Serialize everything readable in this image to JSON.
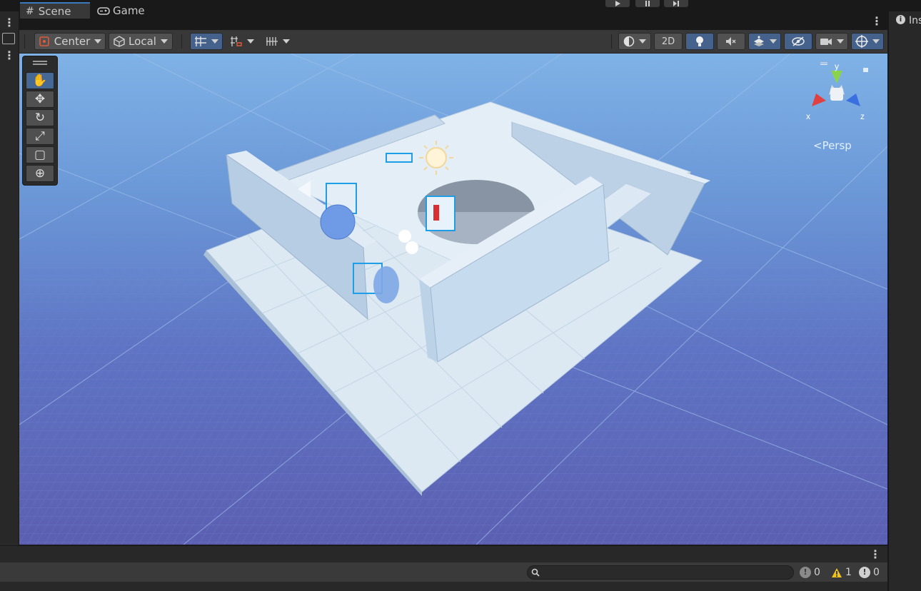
{
  "tabs": {
    "scene": "Scene",
    "game": "Game",
    "inspector": "Ins"
  },
  "toolbar": {
    "pivot_label": "Center",
    "space_label": "Local",
    "mode_2d_label": "2D"
  },
  "gizmo": {
    "x_label": "x",
    "y_label": "y",
    "z_label": "z",
    "projection_label": "<Persp"
  },
  "console_counts": {
    "info": "0",
    "warning": "1",
    "error": "0"
  },
  "search": {
    "placeholder": ""
  },
  "colors": {
    "accent": "#3a79bb",
    "toggle_on": "#44628c",
    "warning": "#f0c417"
  }
}
